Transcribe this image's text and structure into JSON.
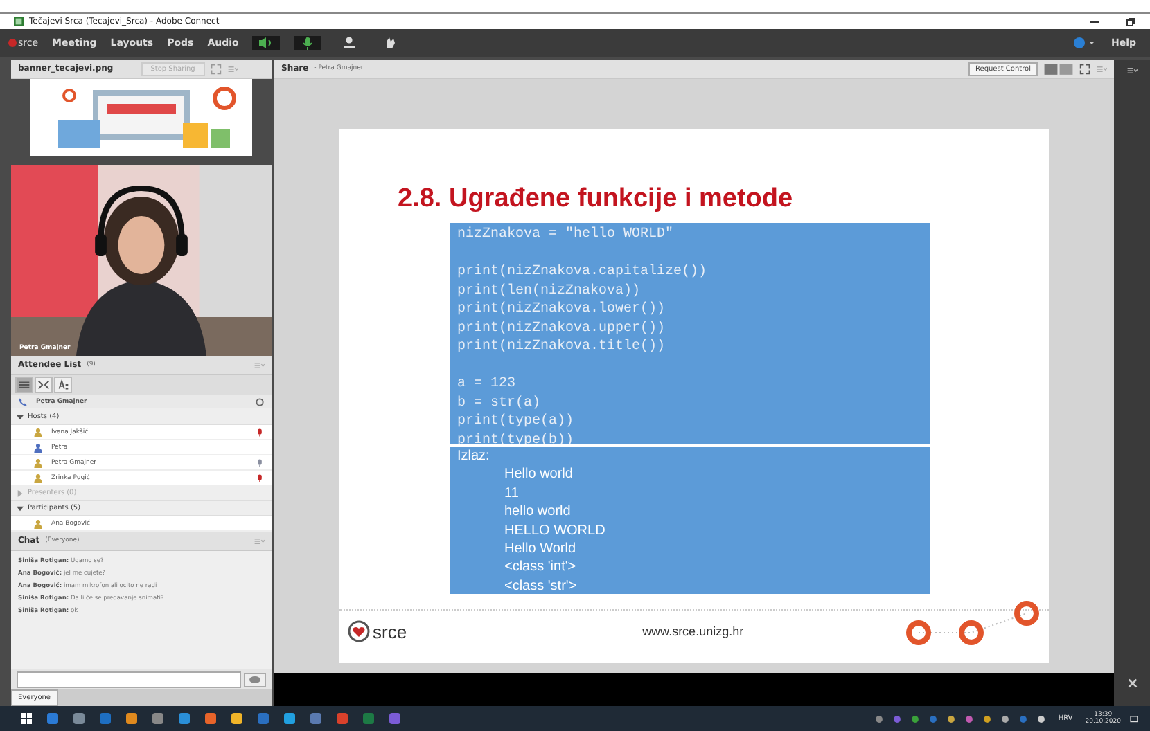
{
  "window": {
    "title": "Tečajevi Srca (Tecajevi_Srca) - Adobe Connect",
    "logo": "srce",
    "menu": [
      "Meeting",
      "Layouts",
      "Pods",
      "Audio"
    ],
    "help": "Help"
  },
  "banner_pod": {
    "title": "banner_tecajevi.png",
    "stop_sharing": "Stop Sharing"
  },
  "video": {
    "name": "Petra Gmajner"
  },
  "attendees": {
    "title": "Attendee List",
    "count": "(9)",
    "presenter": "Petra Gmajner",
    "groups": [
      {
        "label": "Hosts (4)",
        "expanded": true,
        "children": [
          {
            "name": "Ivana Jakšić",
            "color": "#c9a640",
            "kind": "muted"
          },
          {
            "name": "Petra",
            "color": "#4f6fbf",
            "kind": "plain"
          },
          {
            "name": "Petra Gmajner",
            "color": "#c9a640",
            "kind": "idle"
          },
          {
            "name": "Zrinka Pugić",
            "color": "#c9a640",
            "kind": "muted"
          }
        ]
      },
      {
        "label": "Presenters (0)",
        "expanded": false
      },
      {
        "label": "Participants (5)",
        "expanded": true,
        "children": [
          {
            "name": "Ana Bogović",
            "color": "#c9a640",
            "kind": "plain"
          }
        ]
      }
    ]
  },
  "chat": {
    "title": "Chat",
    "scope": "(Everyone)",
    "messages": [
      {
        "author": "Siniša Rotigan:",
        "text": "Ugamo se?"
      },
      {
        "author": "Ana Bogović:",
        "text": "jel me cujete?"
      },
      {
        "author": "Ana Bogović:",
        "text": "imam mikrofon ali ocito ne radi"
      },
      {
        "author": "Siniša Rotigan:",
        "text": "Da li će se predavanje snimati?"
      },
      {
        "author": "Siniša Rotigan:",
        "text": "ok"
      }
    ],
    "tab": "Everyone"
  },
  "share": {
    "title": "Share",
    "presenter": "- Petra Gmajner",
    "request_control": "Request Control",
    "slide": {
      "title": "2.8. Ugrađene funkcije i metode",
      "code_blocks": [
        [
          "nizZnakova = \"hello WORLD\""
        ],
        [
          "print(nizZnakova.capitalize())",
          "print(len(nizZnakova))",
          "print(nizZnakova.lower())",
          "print(nizZnakova.upper())",
          "print(nizZnakova.title())"
        ],
        [
          "a = 123",
          "b = str(a)",
          "print(type(a))",
          "print(type(b))"
        ]
      ],
      "output_label": "Izlaz:",
      "output": [
        "Hello world",
        "11",
        "hello world",
        "HELLO WORLD",
        "Hello World",
        "<class 'int'>",
        "<class 'str'>"
      ],
      "logo": "srce",
      "url": "www.srce.unizg.hr"
    }
  },
  "taskbar": {
    "language": "HRV",
    "time": "13:39",
    "date": "20.10.2020"
  }
}
